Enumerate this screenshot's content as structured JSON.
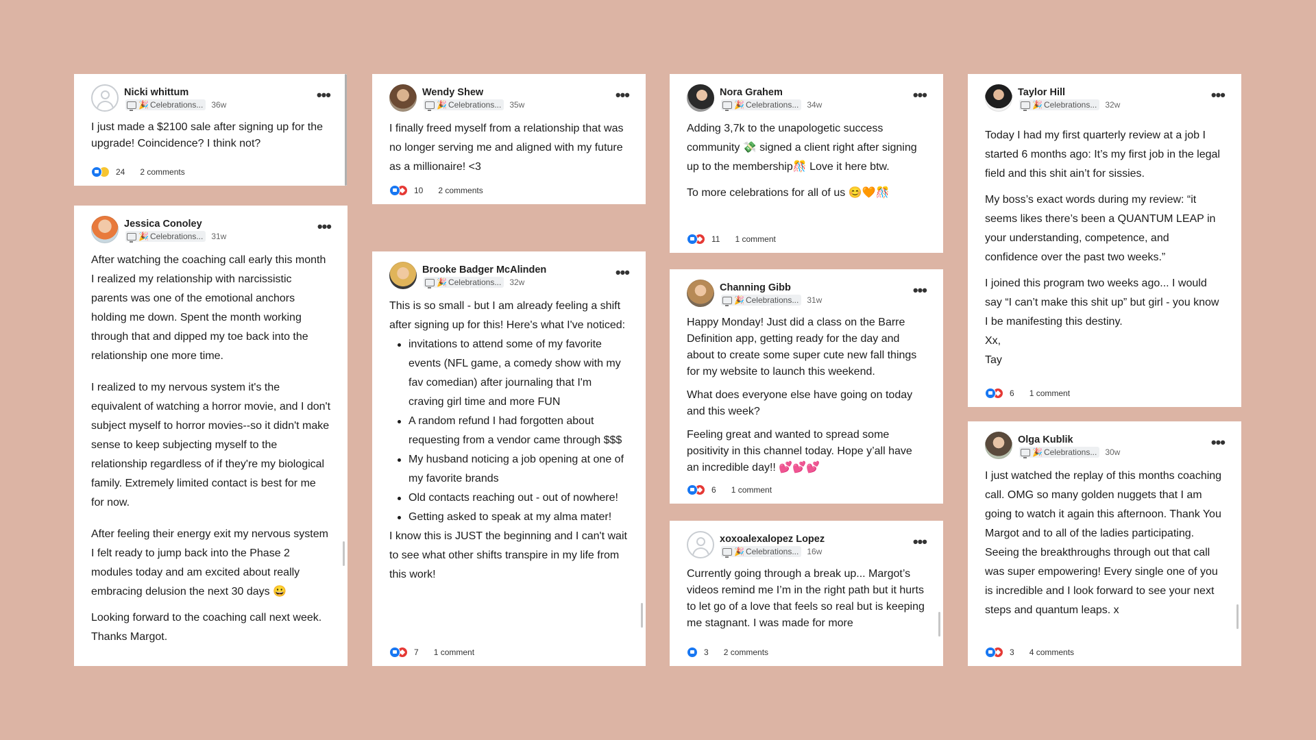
{
  "channel_label": "Celebrations...",
  "more_label": "•••",
  "colors": {
    "background": "#dcb4a4",
    "like": "#1877f2",
    "love": "#e53935"
  },
  "posts": [
    {
      "author": "Nicki whittum",
      "time": "36w",
      "avatar": "placeholder",
      "reactions": [
        "like",
        "haha"
      ],
      "reaction_count": "24",
      "comments": "2 comments",
      "paragraphs": [
        "I just made a $2100 sale after signing up for the upgrade! Coincidence? I think not?"
      ]
    },
    {
      "author": "Jessica Conoley",
      "time": "31w",
      "avatar": "photo",
      "reactions": [
        "like",
        "love"
      ],
      "reaction_count": "",
      "comments": "",
      "paragraphs": [
        "After watching the coaching call early this month I realized my relationship with narcissistic parents was one of the emotional anchors holding me down. Spent the month working through that and dipped my toe back into the relationship one more time.",
        "I realized to my nervous system it's the equivalent of watching a horror movie, and I don't subject myself to horror movies--so it didn't make sense to keep subjecting myself to the relationship regardless of if they're my biological family. Extremely limited contact is best for me for now.",
        "After feeling their energy exit my nervous system I felt ready to jump back into the Phase 2 modules today and am excited about really embracing delusion the next 30 days 😀",
        "Looking forward to the coaching call next week. Thanks Margot."
      ]
    },
    {
      "author": "Wendy Shew",
      "time": "35w",
      "avatar": "photo",
      "reactions": [
        "like",
        "love"
      ],
      "reaction_count": "10",
      "comments": "2 comments",
      "paragraphs": [
        "I finally freed myself from a relationship that was no longer serving me and aligned with my future as a millionaire! <3"
      ]
    },
    {
      "author": "Brooke Badger McAlinden",
      "time": "32w",
      "avatar": "photo",
      "reactions": [
        "like",
        "love"
      ],
      "reaction_count": "7",
      "comments": "1 comment",
      "paragraphs": [
        "This is so small - but I am already feeling a shift after signing up for this! Here's what I've noticed:"
      ],
      "bullets": [
        "invitations to attend some of my favorite events (NFL game, a comedy show with my fav comedian) after journaling that I'm craving girl time and more FUN",
        "A random refund I had forgotten about requesting from a vendor came through $$$",
        "My husband noticing a job opening at one of my favorite brands",
        "Old contacts reaching out - out of nowhere!",
        "Getting asked to speak at my alma mater!"
      ],
      "closing": "I know this is JUST the beginning and I can't wait to see what other shifts transpire in my life from this work!"
    },
    {
      "author": "Nora Grahem",
      "time": "34w",
      "avatar": "photo",
      "reactions": [
        "like",
        "love"
      ],
      "reaction_count": "11",
      "comments": "1 comment",
      "paragraphs": [
        "Adding 3,7k to the unapologetic success community 💸 signed a client right after signing up to the membership🎊 Love it here btw.",
        "To more celebrations for all of us 😊🧡🎊"
      ]
    },
    {
      "author": "Channing Gibb",
      "time": "31w",
      "avatar": "photo",
      "reactions": [
        "like",
        "love"
      ],
      "reaction_count": "6",
      "comments": "1 comment",
      "paragraphs": [
        "Happy Monday! Just did a class on the Barre Definition app, getting ready for the day and about to create some super cute new fall things for my website to launch this weekend.",
        "What does everyone else have going on today and this week?",
        "Feeling great and wanted to spread some positivity in this channel today. Hope y’all have an incredible day!! 💕💕💕"
      ]
    },
    {
      "author": "xoxoalexalopez Lopez",
      "time": "16w",
      "avatar": "placeholder",
      "reactions": [
        "like"
      ],
      "reaction_count": "3",
      "comments": "2 comments",
      "paragraphs": [
        "Currently going through a break up... Margot’s videos remind me I’m in the right path but it hurts to let go of a love that feels so real but is keeping me stagnant. I was made for more"
      ]
    },
    {
      "author": "Taylor Hill",
      "time": "32w",
      "avatar": "photo",
      "reactions": [
        "like",
        "love"
      ],
      "reaction_count": "6",
      "comments": "1 comment",
      "paragraphs": [
        "Today I had my first quarterly review at a job I started 6 months ago: It’s my first job in the legal field and this shit ain’t for sissies.",
        "My boss’s exact words during my review: “it seems likes there’s been a QUANTUM LEAP in your understanding, competence, and confidence over the past two weeks.”",
        "I joined this program two weeks ago... I would say “I can’t make this shit up” but girl - you know I be manifesting this destiny.",
        "Xx,",
        "Tay"
      ]
    },
    {
      "author": "Olga Kublik",
      "time": "30w",
      "avatar": "photo",
      "reactions": [
        "like",
        "love"
      ],
      "reaction_count": "3",
      "comments": "4 comments",
      "paragraphs": [
        "I just watched the replay of this months coaching call. OMG so many golden nuggets that I am going to watch it again this afternoon. Thank You Margot and to all of the ladies participating. Seeing the breakthroughs through out that call was super empowering! Every single one of you is incredible and I look forward to see your next steps and quantum leaps. x"
      ]
    }
  ]
}
